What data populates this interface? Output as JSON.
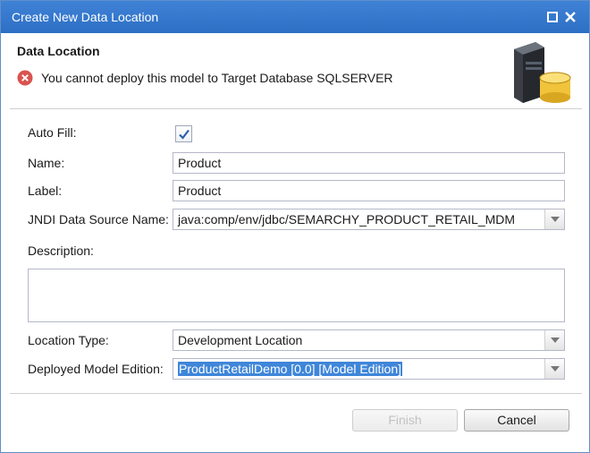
{
  "window": {
    "title": "Create New Data Location",
    "icons": [
      "maximize-icon",
      "close-icon"
    ]
  },
  "header": {
    "section_title": "Data Location",
    "error_message": "You cannot deploy this model to Target Database SQLSERVER",
    "icons": [
      "error-icon",
      "database-server-icon"
    ]
  },
  "form": {
    "auto_fill": {
      "label": "Auto Fill:",
      "checked": true
    },
    "name": {
      "label": "Name:",
      "value": "Product"
    },
    "label": {
      "label": "Label:",
      "value": "Product"
    },
    "jndi": {
      "label": "JNDI Data Source Name:",
      "value": "java:comp/env/jdbc/SEMARCHY_PRODUCT_RETAIL_MDM"
    },
    "description": {
      "label": "Description:",
      "value": ""
    },
    "location_type": {
      "label": "Location Type:",
      "value": "Development Location"
    },
    "deployed_model_edition": {
      "label": "Deployed Model Edition:",
      "value": "ProductRetailDemo [0.0] [Model Edition]"
    }
  },
  "buttons": {
    "finish": "Finish",
    "cancel": "Cancel"
  },
  "colors": {
    "titlebar": "#2d6fc4",
    "error": "#d9534f",
    "selection": "#3f86d9"
  }
}
